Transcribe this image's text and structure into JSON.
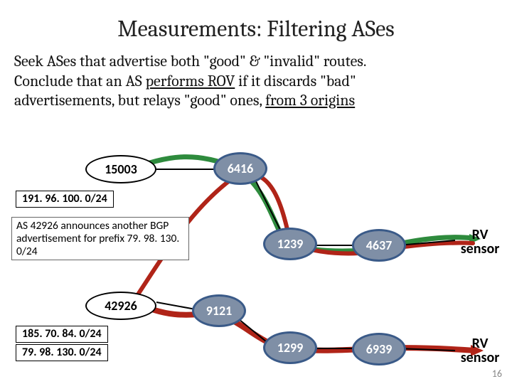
{
  "title": "Measurements: Filtering ASes",
  "paragraph": {
    "line1_a": "Seek ASes that advertise both \"good\" & \"invalid\" routes.",
    "line2_a": "Conclude that an AS ",
    "line2_u": "performs ROV",
    "line2_b": " if it discards \"bad\"",
    "line3_a": "advertisements, but relays \"good\" ones, ",
    "line3_u": "from 3 origins"
  },
  "nodes": {
    "n15003": "15003",
    "n6416": "6416",
    "n1239": "1239",
    "n4637": "4637",
    "n42926": "42926",
    "n9121": "9121",
    "n1299": "1299",
    "n6939": "6939"
  },
  "prefixes": {
    "p191": "191. 96. 100. 0/24",
    "p185": "185. 70. 84. 0/24",
    "p79": "79. 98. 130. 0/24"
  },
  "annotation": "AS 42926 announces another BGP advertisement for prefix 79. 98. 130. 0/24",
  "rv_label": "RV sensor",
  "page": "16"
}
